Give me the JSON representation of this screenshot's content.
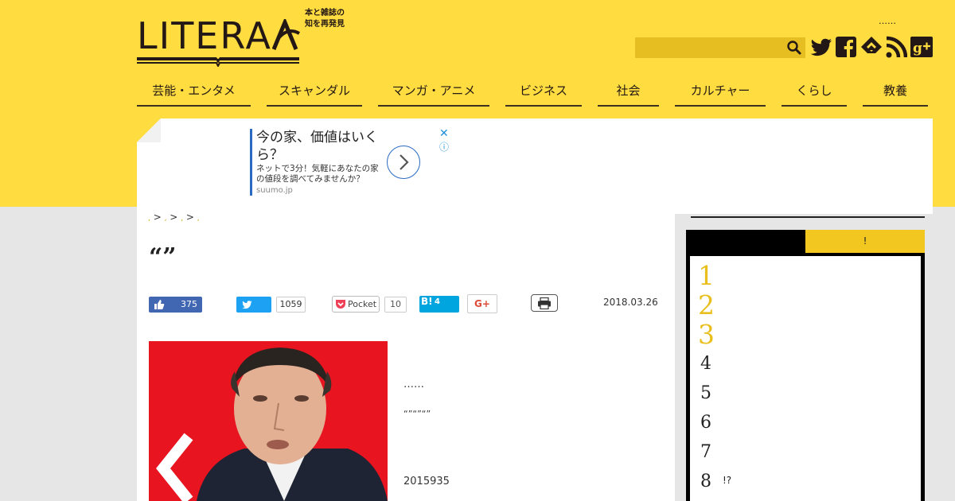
{
  "brand": {
    "logo_text": "LITERA",
    "tagline_line1": "本と雑誌の",
    "tagline_line2": "知を再発見"
  },
  "header": {
    "top_link": "……",
    "search_placeholder": "",
    "accent_color": "#ffdc3f"
  },
  "nav": {
    "items": [
      "芸能・エンタメ",
      "スキャンダル",
      "マンガ・アニメ",
      "ビジネス",
      "社会",
      "カルチャー",
      "くらし",
      "教養"
    ]
  },
  "ad": {
    "title": "今の家、価値はいくら？",
    "subtitle": "ネットで3分！気軽にあなたの家の値段を調べてみませんか？",
    "url": "suumo.jp",
    "close_glyph": "✕",
    "info_glyph": "ⓘ"
  },
  "breadcrumb": {
    "separator": ">"
  },
  "article": {
    "title": "“”",
    "date": "2018.03.26",
    "paragraphs": [
      "……",
      "“”“”“”",
      "2015935"
    ]
  },
  "share": {
    "like_count": "375",
    "tweet_count": "1059",
    "pocket_label": "Pocket",
    "pocket_count": "10",
    "hatena_label": "B!",
    "hatena_count": "4",
    "gplus_label": "G+"
  },
  "sidebar": {
    "tab_active": "",
    "tab_inactive": "!",
    "ranking": [
      {
        "rank": "1",
        "text": ""
      },
      {
        "rank": "2",
        "text": ""
      },
      {
        "rank": "3",
        "text": ""
      },
      {
        "rank": "4",
        "text": ""
      },
      {
        "rank": "5",
        "text": ""
      },
      {
        "rank": "6",
        "text": ""
      },
      {
        "rank": "7",
        "text": ""
      },
      {
        "rank": "8",
        "text": "!?"
      }
    ]
  }
}
